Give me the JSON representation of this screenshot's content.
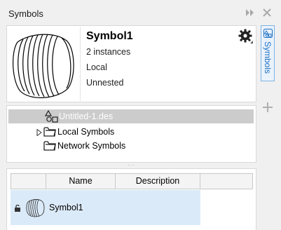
{
  "window": {
    "title": "Symbols"
  },
  "symbol": {
    "name": "Symbol1",
    "instances": "2 instances",
    "scope": "Local",
    "nesting": "Unnested"
  },
  "tree": {
    "items": [
      {
        "label": "Untitled-1.des",
        "selected": true
      },
      {
        "label": "Local Symbols",
        "expandable": true
      },
      {
        "label": "Network Symbols",
        "expandable": false
      }
    ]
  },
  "list": {
    "columns": [
      "Name",
      "Description"
    ],
    "rows": [
      {
        "name": "Symbol1",
        "description": ""
      }
    ]
  },
  "side_tab": {
    "label": "Symbols"
  },
  "colors": {
    "accent": "#1b6fc4",
    "selected_row": "#dbeaf8",
    "tree_selection": "#cccccc"
  }
}
